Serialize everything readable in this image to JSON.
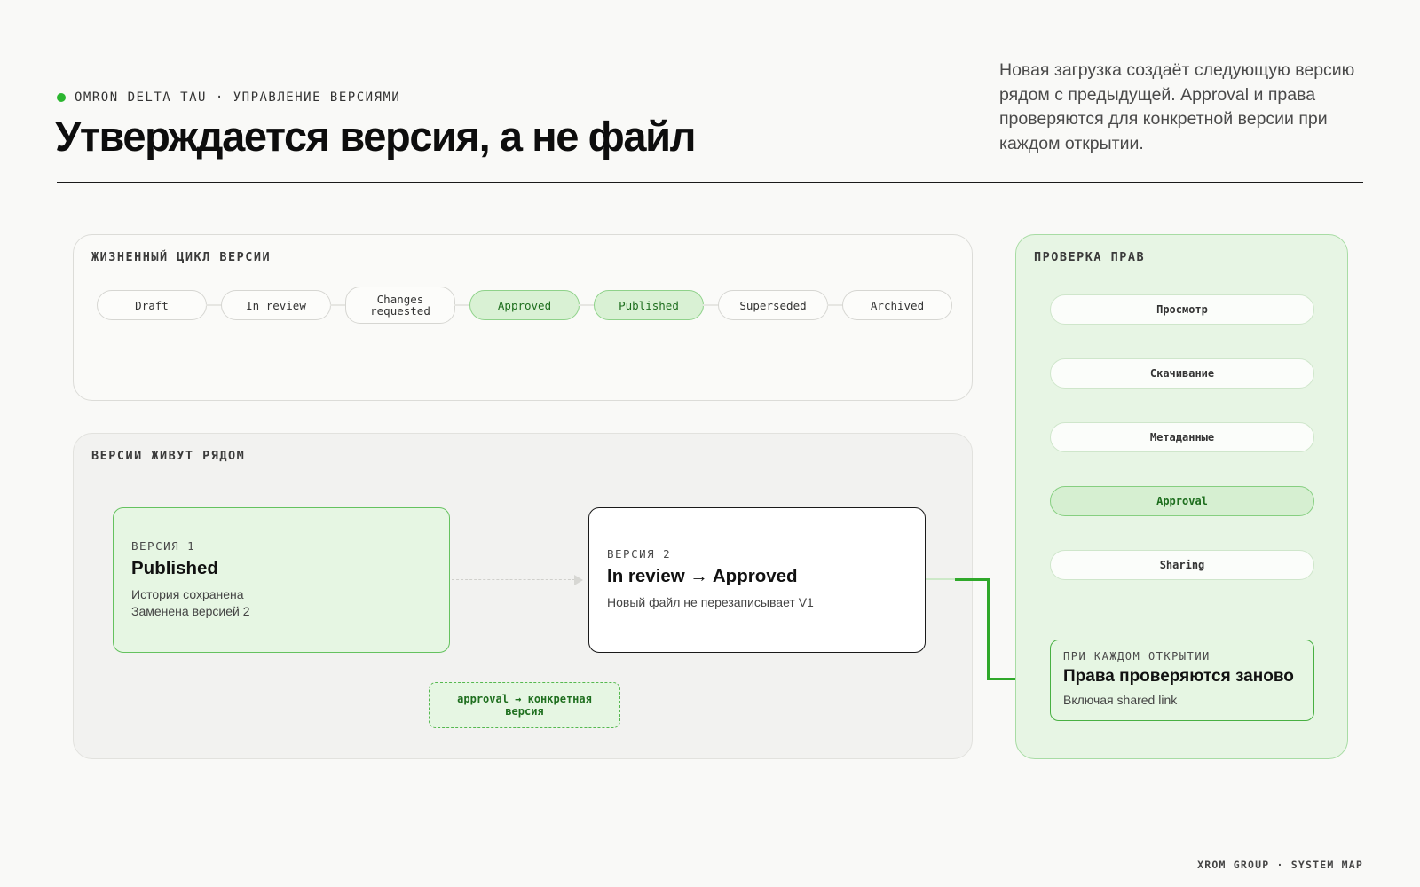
{
  "header": {
    "eyebrow": "OMRON DELTA TAU · УПРАВЛЕНИЕ ВЕРСИЯМИ",
    "title": "Утверждается версия, а не файл",
    "lead": "Новая загрузка создаёт следующую версию рядом с предыдущей. Approval и права проверяются для конкретной версии при каждом открытии."
  },
  "lifecycle": {
    "title": "ЖИЗНЕННЫЙ ЦИКЛ ВЕРСИИ",
    "stages": [
      {
        "label": "Draft",
        "highlighted": false
      },
      {
        "label": "In review",
        "highlighted": false
      },
      {
        "label": "Changes\nrequested",
        "highlighted": false
      },
      {
        "label": "Approved",
        "highlighted": true
      },
      {
        "label": "Published",
        "highlighted": true
      },
      {
        "label": "Superseded",
        "highlighted": false
      },
      {
        "label": "Archived",
        "highlighted": false
      }
    ]
  },
  "versions": {
    "title": "ВЕРСИИ ЖИВУТ РЯДОМ",
    "v1": {
      "label": "ВЕРСИЯ 1",
      "status": "Published",
      "lines": [
        "История сохранена",
        "Заменена версией 2"
      ]
    },
    "v2": {
      "label": "ВЕРСИЯ 2",
      "status": "In review → Approved",
      "lines": [
        "Новый файл не перезаписывает V1"
      ]
    },
    "approval_note": "approval → конкретная версия"
  },
  "rights": {
    "title": "ПРОВЕРКА ПРАВ",
    "checks": [
      {
        "label": "Просмотр",
        "active": false
      },
      {
        "label": "Скачивание",
        "active": false
      },
      {
        "label": "Метаданные",
        "active": false
      },
      {
        "label": "Approval",
        "active": true
      },
      {
        "label": "Sharing",
        "active": false
      }
    ],
    "recheck": {
      "label": "ПРИ КАЖДОМ ОТКРЫТИИ",
      "title": "Права проверяются заново",
      "desc": "Включая shared link"
    }
  },
  "footer": "XROM GROUP · SYSTEM MAP",
  "colors": {
    "accent_green": "#2bb62f",
    "highlight_fill": "#d9f1d4",
    "rule": "#1a1a1a"
  }
}
